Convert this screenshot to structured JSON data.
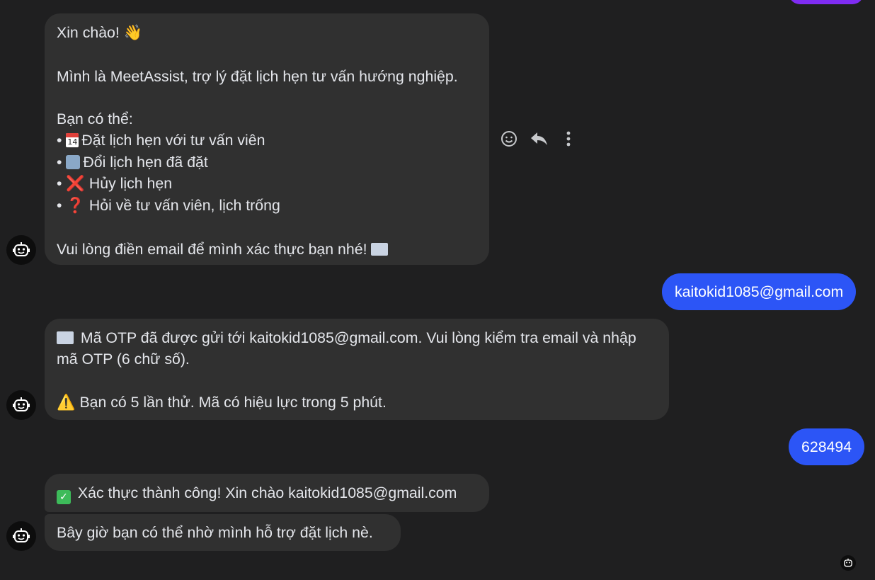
{
  "messages": {
    "bot_welcome": {
      "greeting": "Xin chào!",
      "greeting_emoji": "👋",
      "intro": "Mình là MeetAssist, trợ lý đặt lịch hẹn tư vấn hướng nghiệp.",
      "options_title": "Bạn có thể:",
      "options": [
        {
          "bullet": "•",
          "icon": "calendar-icon",
          "text": "Đặt lịch hẹn với tư vấn viên",
          "icon_text": "14"
        },
        {
          "bullet": "•",
          "icon": "arrows-cycle-icon",
          "text": "Đổi lịch hẹn đã đặt"
        },
        {
          "bullet": "•",
          "icon": "red-x-icon",
          "text": "Hủy lịch hẹn",
          "icon_text": "❌"
        },
        {
          "bullet": "•",
          "icon": "question-mark-icon",
          "text": "Hỏi về tư vấn viên, lịch trống",
          "icon_text": "❓"
        }
      ],
      "closing": "Vui lòng điền email để mình xác thực bạn nhé!",
      "closing_icon": "email-icon"
    },
    "user_email": "kaitokid1085@gmail.com",
    "bot_otp": {
      "icon": "email-icon",
      "line1": "Mã OTP đã được gửi tới kaitokid1085@gmail.com. Vui lòng kiểm tra email và nhập mã OTP (6 chữ số).",
      "warning_icon": "⚠️",
      "line2": "Bạn có 5 lần thử. Mã có hiệu lực trong 5 phút."
    },
    "user_otp": "628494",
    "bot_success": {
      "icon": "check-mark-icon",
      "icon_text": "✓",
      "text": "Xác thực thành công! Xin chào kaitokid1085@gmail.com"
    },
    "bot_followup": "Bây giờ bạn có thể nhờ mình hỗ trợ đặt lịch nè."
  },
  "actions": [
    {
      "name": "react-emoji-icon"
    },
    {
      "name": "reply-icon"
    },
    {
      "name": "more-options-icon"
    }
  ],
  "colors": {
    "background": "#1f1f20",
    "bot_bubble": "#303030",
    "user_bubble": "#2c55f6",
    "text": "#e4e6eb",
    "top_bubble": "#7f2cf2"
  }
}
